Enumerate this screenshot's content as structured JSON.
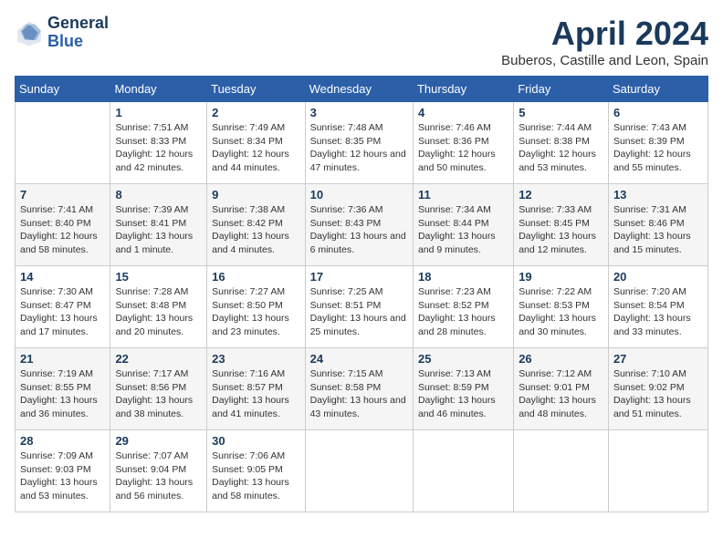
{
  "logo": {
    "text_general": "General",
    "text_blue": "Blue"
  },
  "header": {
    "title": "April 2024",
    "subtitle": "Buberos, Castille and Leon, Spain"
  },
  "weekdays": [
    "Sunday",
    "Monday",
    "Tuesday",
    "Wednesday",
    "Thursday",
    "Friday",
    "Saturday"
  ],
  "weeks": [
    [
      {
        "day": "",
        "sunrise": "",
        "sunset": "",
        "daylight": ""
      },
      {
        "day": "1",
        "sunrise": "Sunrise: 7:51 AM",
        "sunset": "Sunset: 8:33 PM",
        "daylight": "Daylight: 12 hours and 42 minutes."
      },
      {
        "day": "2",
        "sunrise": "Sunrise: 7:49 AM",
        "sunset": "Sunset: 8:34 PM",
        "daylight": "Daylight: 12 hours and 44 minutes."
      },
      {
        "day": "3",
        "sunrise": "Sunrise: 7:48 AM",
        "sunset": "Sunset: 8:35 PM",
        "daylight": "Daylight: 12 hours and 47 minutes."
      },
      {
        "day": "4",
        "sunrise": "Sunrise: 7:46 AM",
        "sunset": "Sunset: 8:36 PM",
        "daylight": "Daylight: 12 hours and 50 minutes."
      },
      {
        "day": "5",
        "sunrise": "Sunrise: 7:44 AM",
        "sunset": "Sunset: 8:38 PM",
        "daylight": "Daylight: 12 hours and 53 minutes."
      },
      {
        "day": "6",
        "sunrise": "Sunrise: 7:43 AM",
        "sunset": "Sunset: 8:39 PM",
        "daylight": "Daylight: 12 hours and 55 minutes."
      }
    ],
    [
      {
        "day": "7",
        "sunrise": "Sunrise: 7:41 AM",
        "sunset": "Sunset: 8:40 PM",
        "daylight": "Daylight: 12 hours and 58 minutes."
      },
      {
        "day": "8",
        "sunrise": "Sunrise: 7:39 AM",
        "sunset": "Sunset: 8:41 PM",
        "daylight": "Daylight: 13 hours and 1 minute."
      },
      {
        "day": "9",
        "sunrise": "Sunrise: 7:38 AM",
        "sunset": "Sunset: 8:42 PM",
        "daylight": "Daylight: 13 hours and 4 minutes."
      },
      {
        "day": "10",
        "sunrise": "Sunrise: 7:36 AM",
        "sunset": "Sunset: 8:43 PM",
        "daylight": "Daylight: 13 hours and 6 minutes."
      },
      {
        "day": "11",
        "sunrise": "Sunrise: 7:34 AM",
        "sunset": "Sunset: 8:44 PM",
        "daylight": "Daylight: 13 hours and 9 minutes."
      },
      {
        "day": "12",
        "sunrise": "Sunrise: 7:33 AM",
        "sunset": "Sunset: 8:45 PM",
        "daylight": "Daylight: 13 hours and 12 minutes."
      },
      {
        "day": "13",
        "sunrise": "Sunrise: 7:31 AM",
        "sunset": "Sunset: 8:46 PM",
        "daylight": "Daylight: 13 hours and 15 minutes."
      }
    ],
    [
      {
        "day": "14",
        "sunrise": "Sunrise: 7:30 AM",
        "sunset": "Sunset: 8:47 PM",
        "daylight": "Daylight: 13 hours and 17 minutes."
      },
      {
        "day": "15",
        "sunrise": "Sunrise: 7:28 AM",
        "sunset": "Sunset: 8:48 PM",
        "daylight": "Daylight: 13 hours and 20 minutes."
      },
      {
        "day": "16",
        "sunrise": "Sunrise: 7:27 AM",
        "sunset": "Sunset: 8:50 PM",
        "daylight": "Daylight: 13 hours and 23 minutes."
      },
      {
        "day": "17",
        "sunrise": "Sunrise: 7:25 AM",
        "sunset": "Sunset: 8:51 PM",
        "daylight": "Daylight: 13 hours and 25 minutes."
      },
      {
        "day": "18",
        "sunrise": "Sunrise: 7:23 AM",
        "sunset": "Sunset: 8:52 PM",
        "daylight": "Daylight: 13 hours and 28 minutes."
      },
      {
        "day": "19",
        "sunrise": "Sunrise: 7:22 AM",
        "sunset": "Sunset: 8:53 PM",
        "daylight": "Daylight: 13 hours and 30 minutes."
      },
      {
        "day": "20",
        "sunrise": "Sunrise: 7:20 AM",
        "sunset": "Sunset: 8:54 PM",
        "daylight": "Daylight: 13 hours and 33 minutes."
      }
    ],
    [
      {
        "day": "21",
        "sunrise": "Sunrise: 7:19 AM",
        "sunset": "Sunset: 8:55 PM",
        "daylight": "Daylight: 13 hours and 36 minutes."
      },
      {
        "day": "22",
        "sunrise": "Sunrise: 7:17 AM",
        "sunset": "Sunset: 8:56 PM",
        "daylight": "Daylight: 13 hours and 38 minutes."
      },
      {
        "day": "23",
        "sunrise": "Sunrise: 7:16 AM",
        "sunset": "Sunset: 8:57 PM",
        "daylight": "Daylight: 13 hours and 41 minutes."
      },
      {
        "day": "24",
        "sunrise": "Sunrise: 7:15 AM",
        "sunset": "Sunset: 8:58 PM",
        "daylight": "Daylight: 13 hours and 43 minutes."
      },
      {
        "day": "25",
        "sunrise": "Sunrise: 7:13 AM",
        "sunset": "Sunset: 8:59 PM",
        "daylight": "Daylight: 13 hours and 46 minutes."
      },
      {
        "day": "26",
        "sunrise": "Sunrise: 7:12 AM",
        "sunset": "Sunset: 9:01 PM",
        "daylight": "Daylight: 13 hours and 48 minutes."
      },
      {
        "day": "27",
        "sunrise": "Sunrise: 7:10 AM",
        "sunset": "Sunset: 9:02 PM",
        "daylight": "Daylight: 13 hours and 51 minutes."
      }
    ],
    [
      {
        "day": "28",
        "sunrise": "Sunrise: 7:09 AM",
        "sunset": "Sunset: 9:03 PM",
        "daylight": "Daylight: 13 hours and 53 minutes."
      },
      {
        "day": "29",
        "sunrise": "Sunrise: 7:07 AM",
        "sunset": "Sunset: 9:04 PM",
        "daylight": "Daylight: 13 hours and 56 minutes."
      },
      {
        "day": "30",
        "sunrise": "Sunrise: 7:06 AM",
        "sunset": "Sunset: 9:05 PM",
        "daylight": "Daylight: 13 hours and 58 minutes."
      },
      {
        "day": "",
        "sunrise": "",
        "sunset": "",
        "daylight": ""
      },
      {
        "day": "",
        "sunrise": "",
        "sunset": "",
        "daylight": ""
      },
      {
        "day": "",
        "sunrise": "",
        "sunset": "",
        "daylight": ""
      },
      {
        "day": "",
        "sunrise": "",
        "sunset": "",
        "daylight": ""
      }
    ]
  ]
}
